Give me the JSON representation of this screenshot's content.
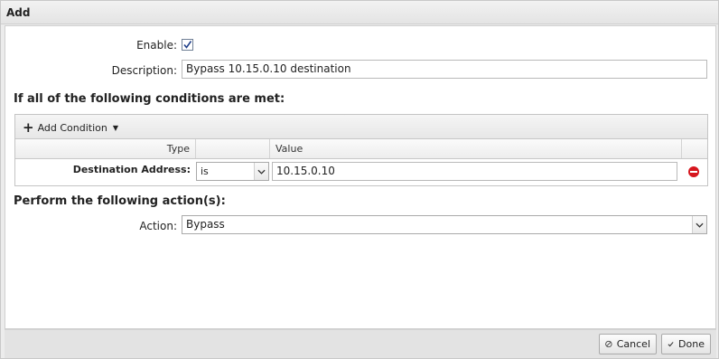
{
  "dialog": {
    "title": "Add"
  },
  "form": {
    "enable_label": "Enable:",
    "enable_checked": true,
    "description_label": "Description:",
    "description_value": "Bypass 10.15.0.10 destination"
  },
  "conditions": {
    "heading": "If all of the following conditions are met:",
    "add_condition_label": "Add Condition",
    "columns": {
      "type": "Type",
      "operator": "",
      "value": "Value"
    },
    "rows": [
      {
        "type": "Destination Address:",
        "operator": "is",
        "value": "10.15.0.10"
      }
    ]
  },
  "actions": {
    "heading": "Perform the following action(s):",
    "action_label": "Action:",
    "action_value": "Bypass"
  },
  "footer": {
    "cancel_label": "Cancel",
    "done_label": "Done"
  },
  "icons": {
    "add": "plus-icon",
    "dropdown": "caret-down-icon",
    "remove": "remove-circle-icon",
    "cancel": "cancel-circle-icon",
    "done": "check-icon"
  },
  "colors": {
    "remove_red": "#d6161e",
    "checkbox_border": "#6f7f95"
  }
}
